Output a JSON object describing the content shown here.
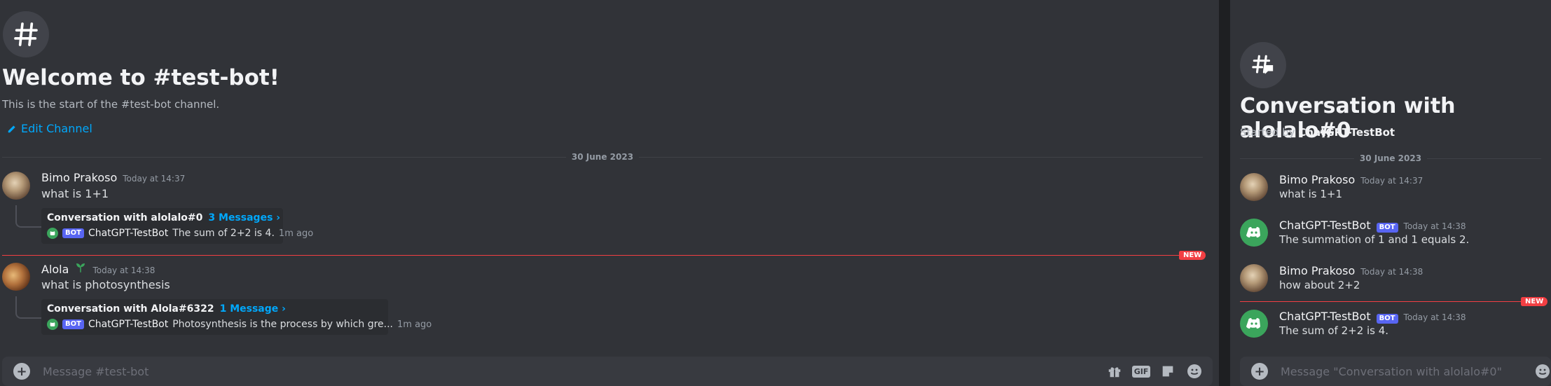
{
  "left": {
    "welcome_title": "Welcome to #test-bot!",
    "welcome_subtitle": "This is the start of the #test-bot channel.",
    "edit_channel": "Edit Channel",
    "date_divider": "30 June 2023",
    "messages": [
      {
        "author": "Bimo Prakoso",
        "timestamp": "Today at 14:37",
        "text": "what is 1+1",
        "thread": {
          "title": "Conversation with alolalo#0",
          "count": "3 Messages ›",
          "bot_name": "ChatGPT-TestBot",
          "bot_tag": "BOT",
          "preview": "The sum of 2+2 is 4.",
          "ago": "1m ago"
        }
      },
      {
        "author": "Alola",
        "timestamp": "Today at 14:38",
        "text": "what is photosynthesis",
        "thread": {
          "title": "Conversation with Alola#6322",
          "count": "1 Message ›",
          "bot_name": "ChatGPT-TestBot",
          "bot_tag": "BOT",
          "preview": "Photosynthesis is the process by which gre...",
          "ago": "1m ago"
        }
      }
    ],
    "new_badge": "NEW",
    "composer_placeholder": "Message #test-bot",
    "composer_icons": [
      "gift-icon",
      "gif-icon",
      "sticker-icon",
      "emoji-icon"
    ],
    "gif_label": "GIF"
  },
  "right": {
    "title": "Conversation with alolalo#0",
    "started_by_prefix": "Started by",
    "started_by_name": "ChatGPT-TestBot",
    "date_divider": "30 June 2023",
    "messages": [
      {
        "author": "Bimo Prakoso",
        "timestamp": "Today at 14:37",
        "text": "what is 1+1"
      },
      {
        "author": "ChatGPT-TestBot",
        "bot_tag": "BOT",
        "timestamp": "Today at 14:38",
        "text": "The summation of 1 and 1 equals 2."
      },
      {
        "author": "Bimo Prakoso",
        "timestamp": "Today at 14:38",
        "text": "how about 2+2"
      },
      {
        "author": "ChatGPT-TestBot",
        "bot_tag": "BOT",
        "timestamp": "Today at 14:38",
        "text": "The sum of 2+2 is 4."
      }
    ],
    "new_badge": "NEW",
    "composer_placeholder": "Message \"Conversation with alolalo#0\""
  },
  "colors": {
    "background": "#313338",
    "link": "#00a8fc",
    "bot_tag": "#5865f2",
    "new_marker": "#f23f43",
    "bot_avatar": "#3ba55c"
  }
}
